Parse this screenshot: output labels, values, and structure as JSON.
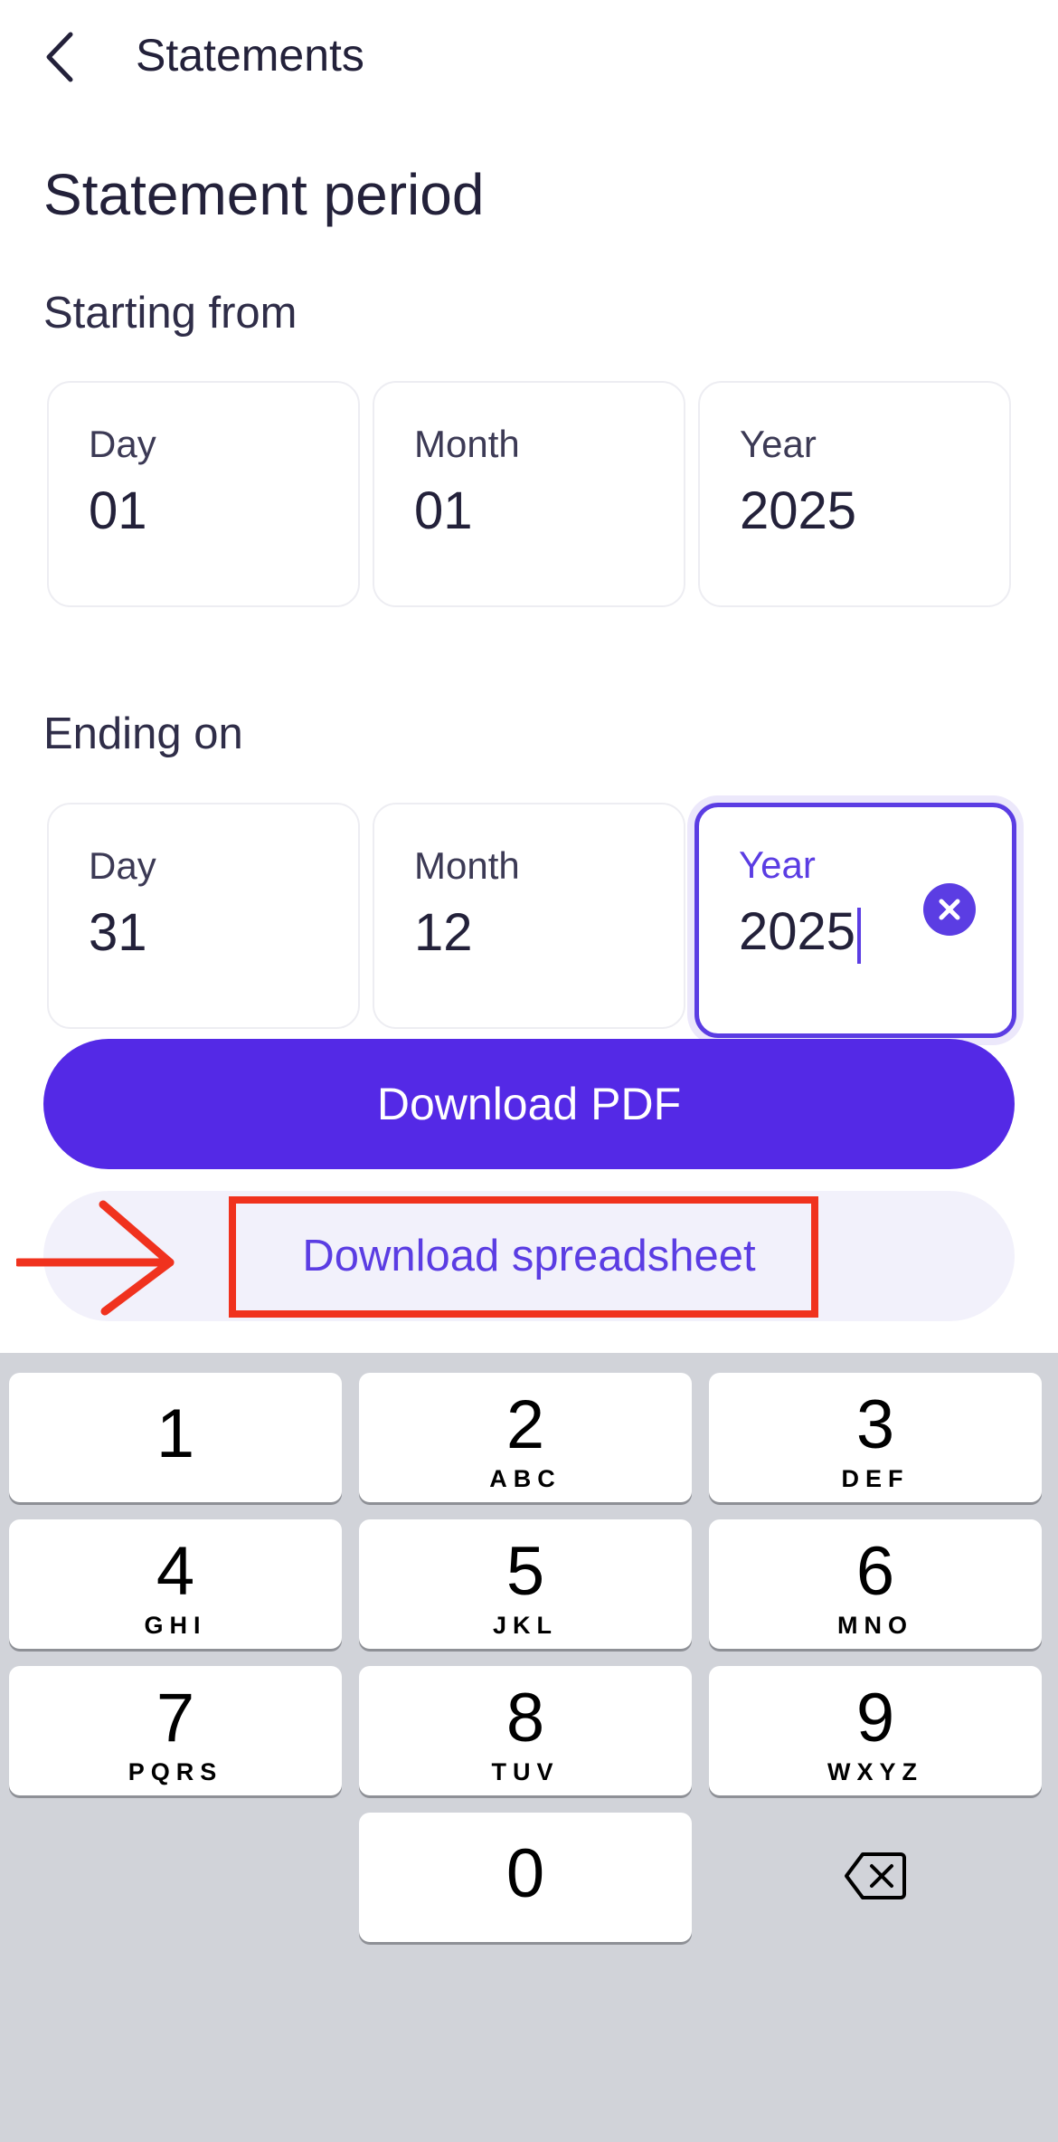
{
  "header": {
    "title": "Statements"
  },
  "page_title": "Statement period",
  "start": {
    "label": "Starting from",
    "day": {
      "label": "Day",
      "value": "01"
    },
    "month": {
      "label": "Month",
      "value": "01"
    },
    "year": {
      "label": "Year",
      "value": "2025"
    }
  },
  "end": {
    "label": "Ending on",
    "day": {
      "label": "Day",
      "value": "31"
    },
    "month": {
      "label": "Month",
      "value": "12"
    },
    "year": {
      "label": "Year",
      "value": "2025"
    }
  },
  "buttons": {
    "pdf": "Download PDF",
    "spreadsheet": "Download spreadsheet"
  },
  "keypad": {
    "k1": {
      "num": "1",
      "letters": ""
    },
    "k2": {
      "num": "2",
      "letters": "ABC"
    },
    "k3": {
      "num": "3",
      "letters": "DEF"
    },
    "k4": {
      "num": "4",
      "letters": "GHI"
    },
    "k5": {
      "num": "5",
      "letters": "JKL"
    },
    "k6": {
      "num": "6",
      "letters": "MNO"
    },
    "k7": {
      "num": "7",
      "letters": "PQRS"
    },
    "k8": {
      "num": "8",
      "letters": "TUV"
    },
    "k9": {
      "num": "9",
      "letters": "WXYZ"
    },
    "k0": {
      "num": "0",
      "letters": ""
    }
  },
  "colors": {
    "accent": "#5429e6",
    "accent_text": "#5b3de3",
    "secondary_bg": "#f2f1fb",
    "annotation_red": "#f0321e",
    "keypad_bg": "#d1d3d9"
  },
  "icons": [
    "chevron-left-icon",
    "clear-icon",
    "backspace-icon",
    "arrow-right-icon"
  ]
}
